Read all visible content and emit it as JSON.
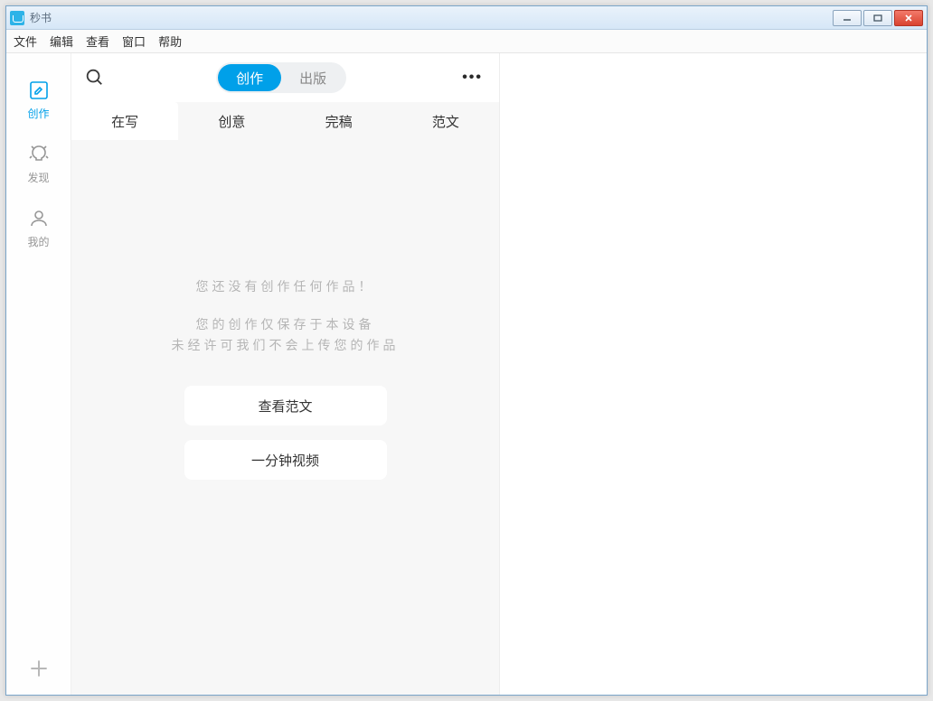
{
  "title": "秒书",
  "menubar": {
    "file": "文件",
    "edit": "编辑",
    "view": "查看",
    "window": "窗口",
    "help": "帮助"
  },
  "sidebar": {
    "items": [
      {
        "label": "创作",
        "icon": "compose-icon"
      },
      {
        "label": "发现",
        "icon": "discover-icon"
      },
      {
        "label": "我的",
        "icon": "user-icon"
      }
    ]
  },
  "header": {
    "segments": {
      "create": "创作",
      "publish": "出版"
    }
  },
  "tabs": [
    {
      "label": "在写"
    },
    {
      "label": "创意"
    },
    {
      "label": "完稿"
    },
    {
      "label": "范文"
    }
  ],
  "empty": {
    "line1": "您还没有创作任何作品！",
    "line2": "您的创作仅保存于本设备",
    "line3": "未经许可我们不会上传您的作品",
    "btn_sample": "查看范文",
    "btn_video": "一分钟视频"
  }
}
